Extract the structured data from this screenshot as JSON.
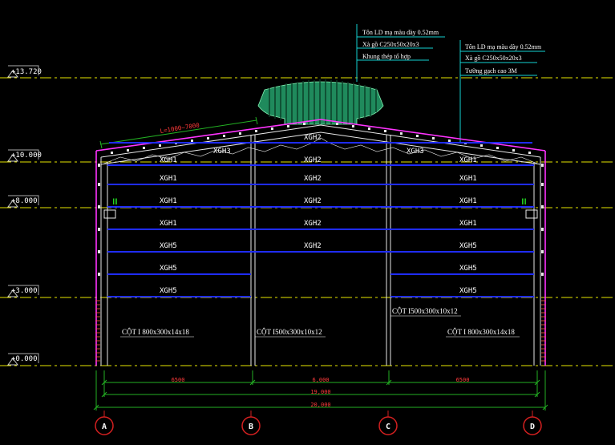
{
  "colors": {
    "background": "#000000",
    "level_line": "#e6e600",
    "steel": "#e8e8e8",
    "beam": "#1f2cff",
    "roof_outline": "#ff33ff",
    "leader": "#14d2d2",
    "dimension": "#23b123",
    "red_dim": "#ff3a3a",
    "ridge_vent": "#1f8a5c",
    "grid_bubble": "#d42020",
    "label": "#ffffff",
    "callout_text": "#ffffff",
    "brick": "#ff5a3c"
  },
  "levels": [
    {
      "label": "+13.720",
      "value": 13.72
    },
    {
      "label": "+10.000",
      "value": 10.0
    },
    {
      "label": "+8.000",
      "value": 8.0
    },
    {
      "label": "+3.000",
      "value": 3.0
    },
    {
      "label": "+0.000",
      "value": 0.0
    }
  ],
  "callouts": {
    "ridge": [
      "Tôn LD mạ màu dày 0.52mm",
      "Xà gồ C250x50x20x3",
      "Khung thép tổ hợp"
    ],
    "right": [
      "Tôn LD mạ màu dày 0.52mm",
      "Xà gồ C250x50x20x3",
      "Tường gạch cao 3M"
    ]
  },
  "rafter_dim": "L=1000~7000",
  "beam_labels": {
    "ridge": "XGH2",
    "top_left": "XGH3",
    "top_right": "XGH3",
    "left": [
      "XGH1",
      "XGH1",
      "XGH1",
      "XGH1",
      "XGH5",
      "XGH5"
    ],
    "center": [
      "XGH2",
      "XGH2",
      "XGH2",
      "XGH2",
      "XGH2"
    ],
    "right": [
      "XGH1",
      "XGH1",
      "XGH1",
      "XGH1",
      "XGH5",
      "XGH5"
    ]
  },
  "column_labels": {
    "left": "CỘT I 800x300x14x18",
    "center_b": "CỘT I500x300x10x12",
    "center_c": "CỘT I500x300x10x12",
    "right": "CỘT I 800x300x14x18"
  },
  "dimensions": {
    "bays": [
      "6500",
      "6,000",
      "6500"
    ],
    "inner": "19,000",
    "overall": "20,000"
  },
  "grid_axes": [
    "A",
    "B",
    "C",
    "D"
  ]
}
